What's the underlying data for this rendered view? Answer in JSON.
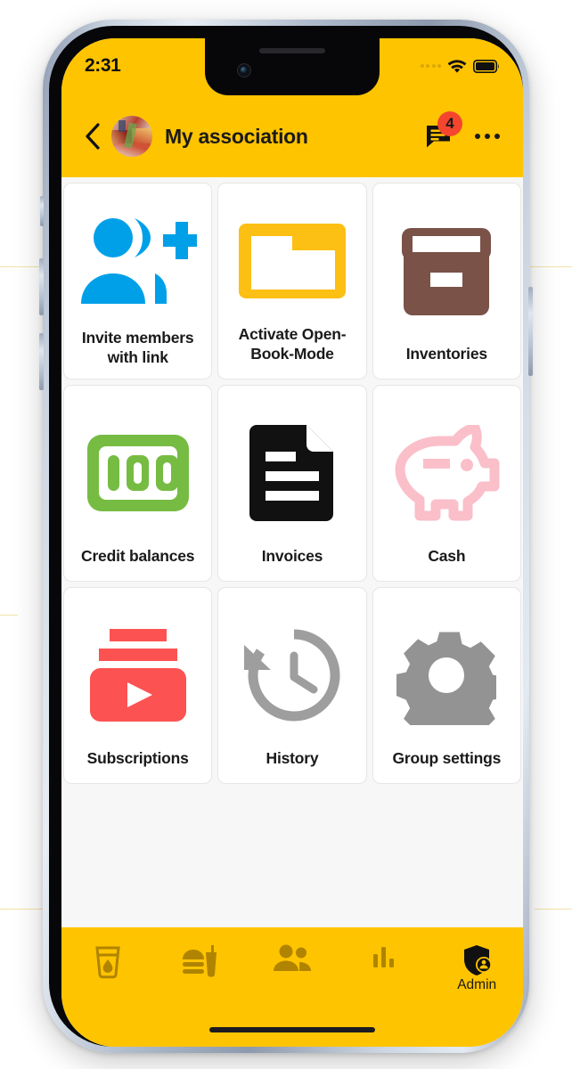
{
  "status_bar": {
    "time": "2:31",
    "signal_icon": "signal-dots-icon",
    "wifi_icon": "wifi-icon",
    "battery_icon": "battery-full-icon"
  },
  "app_bar": {
    "back_icon": "back-chevron-icon",
    "avatar_icon": "group-avatar-photo",
    "title": "My association",
    "chat_icon": "chat-bubble-icon",
    "chat_badge_count": "4",
    "more_icon": "more-options-icon"
  },
  "grid": {
    "tiles": [
      {
        "label": "Invite members with link",
        "icon": "invite-members-icon",
        "color": "#00a0e9"
      },
      {
        "label": "Activate Open-Book-Mode",
        "icon": "open-book-folder-icon",
        "color": "#fcbf13"
      },
      {
        "label": "Inventories",
        "icon": "archive-box-icon",
        "color": "#7a5248"
      },
      {
        "label": "Credit balances",
        "icon": "banknote-100-icon",
        "color": "#76bc43"
      },
      {
        "label": "Invoices",
        "icon": "invoice-document-icon",
        "color": "#111111"
      },
      {
        "label": "Cash",
        "icon": "piggy-bank-icon",
        "color": "#fabfc9"
      },
      {
        "label": "Subscriptions",
        "icon": "subscriptions-play-icon",
        "color": "#fc5252"
      },
      {
        "label": "History",
        "icon": "history-clock-icon",
        "color": "#9e9e9e"
      },
      {
        "label": "Group settings",
        "icon": "gear-settings-icon",
        "color": "#939393"
      }
    ]
  },
  "bottom_nav": {
    "items": [
      {
        "label": "",
        "icon": "drink-glass-icon"
      },
      {
        "label": "",
        "icon": "fast-food-icon"
      },
      {
        "label": "",
        "icon": "people-group-icon"
      },
      {
        "label": "",
        "icon": "bar-chart-icon"
      },
      {
        "label": "Admin",
        "icon": "admin-shield-person-icon"
      }
    ]
  },
  "theme": {
    "accent_yellow": "#ffc400",
    "page_background": "#f7f7f7",
    "tile_background": "#ffffff",
    "badge_red": "#f4462e"
  }
}
